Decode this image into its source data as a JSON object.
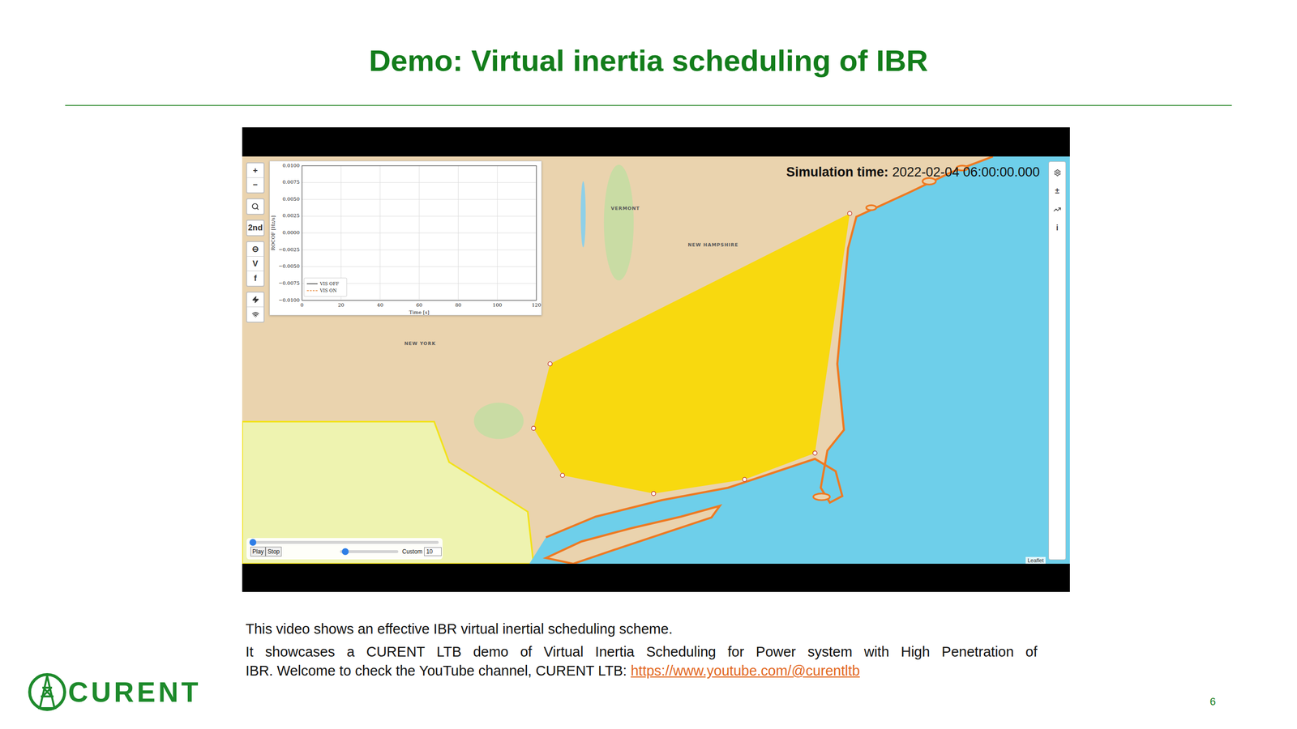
{
  "slide": {
    "title": "Demo: Virtual inertia scheduling of IBR",
    "page_number": "6",
    "logo": {
      "text": "CURENT"
    },
    "caption": {
      "intro": "This video shows an effective IBR virtual inertial scheduling scheme.",
      "lines": [
        "It showcases a CURENT LTB demo of Virtual Inertia Scheduling for Power system with High Penetration of",
        "IBR. Welcome to check the YouTube channel, CURENT LTB: "
      ],
      "link": "https://www.youtube.com/@curentltb"
    }
  },
  "video": {
    "simulation_time": {
      "label": "Simulation time:",
      "value": "2022-02-04 06:00:00.000"
    },
    "map_toolbar": [
      [
        {
          "kind": "text",
          "label": "+"
        },
        {
          "kind": "text",
          "label": "−"
        }
      ],
      [
        {
          "kind": "search",
          "label": ""
        }
      ],
      [
        {
          "kind": "text",
          "label": "2nd"
        }
      ],
      [
        {
          "kind": "text",
          "label": "⊖"
        },
        {
          "kind": "text",
          "label": "V"
        },
        {
          "kind": "text",
          "label": "f"
        }
      ],
      [
        {
          "kind": "bolt",
          "label": ""
        },
        {
          "kind": "wifi",
          "label": ""
        }
      ]
    ],
    "right_bar": [
      {
        "kind": "gear",
        "label": ""
      },
      {
        "kind": "text",
        "label": "±"
      },
      {
        "kind": "chart",
        "label": ""
      },
      {
        "kind": "text",
        "label": "i"
      }
    ],
    "map": {
      "labels": [
        "VERMONT",
        "NEW HAMPSHIRE",
        "NEW YORK"
      ]
    },
    "chart": {
      "y_label": "ROCOF [Hz/s]",
      "x_label": "Time [s]",
      "y_ticks": [
        "0.0100",
        "0.0075",
        "0.0050",
        "0.0025",
        "0.0000",
        "−0.0025",
        "−0.0050",
        "−0.0075",
        "−0.0100"
      ],
      "x_ticks": [
        "0",
        "20",
        "40",
        "60",
        "80",
        "100",
        "120"
      ],
      "series": [
        {
          "name": "VIS OFF",
          "kind": "solid",
          "color": "#333333",
          "values": []
        },
        {
          "name": "VIS ON",
          "kind": "dashed",
          "color": "#e8883a",
          "values": []
        }
      ]
    },
    "playback": {
      "timeline": {
        "level": 0
      },
      "buttons": [
        "Play",
        "Stop"
      ],
      "speed": {
        "level": 0.05
      },
      "custom_label": "Custom",
      "custom_value": "10"
    },
    "attribution": "Leaflet"
  }
}
